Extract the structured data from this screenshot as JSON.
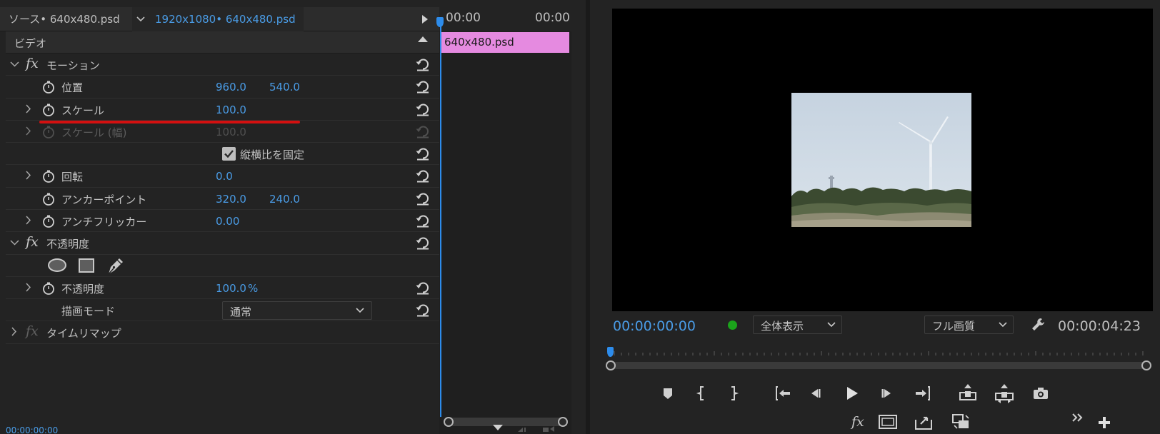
{
  "effect_controls": {
    "source_tab": "ソース• 640x480.psd",
    "sequence_tab": "1920x1080• 640x480.psd",
    "section_video": "ビデオ",
    "motion_label": "モーション",
    "properties": [
      {
        "name": "位置",
        "v1": "960.0",
        "v2": "540.0"
      },
      {
        "name": "スケール",
        "v1": "100.0"
      },
      {
        "name": "スケール (幅)",
        "v1": "100.0"
      },
      {
        "name": "縦横比を固定",
        "checked": true
      },
      {
        "name": "回転",
        "v1": "0.0"
      },
      {
        "name": "アンカーポイント",
        "v1": "320.0",
        "v2": "240.0"
      },
      {
        "name": "アンチフリッカー",
        "v1": "0.00"
      }
    ],
    "opacity_label": "不透明度",
    "opacity_prop": {
      "name": "不透明度",
      "v1": "100.0",
      "unit": "%"
    },
    "blend_mode": {
      "name": "描画モード",
      "value": "通常"
    },
    "time_remap_label": "タイムリマップ",
    "bottom_timecode": "00:00:00:00"
  },
  "timeline": {
    "ruler_start": "00:00",
    "ruler_end": "00:00",
    "clip_label": "640x480.psd",
    "clip_color": "#e58ae0"
  },
  "program_monitor": {
    "timecode_current": "00:00:00:00",
    "zoom_select": "全体表示",
    "quality_select": "フル画質",
    "timecode_duration": "00:00:04:23",
    "accent_color": "#4a9ce6"
  }
}
